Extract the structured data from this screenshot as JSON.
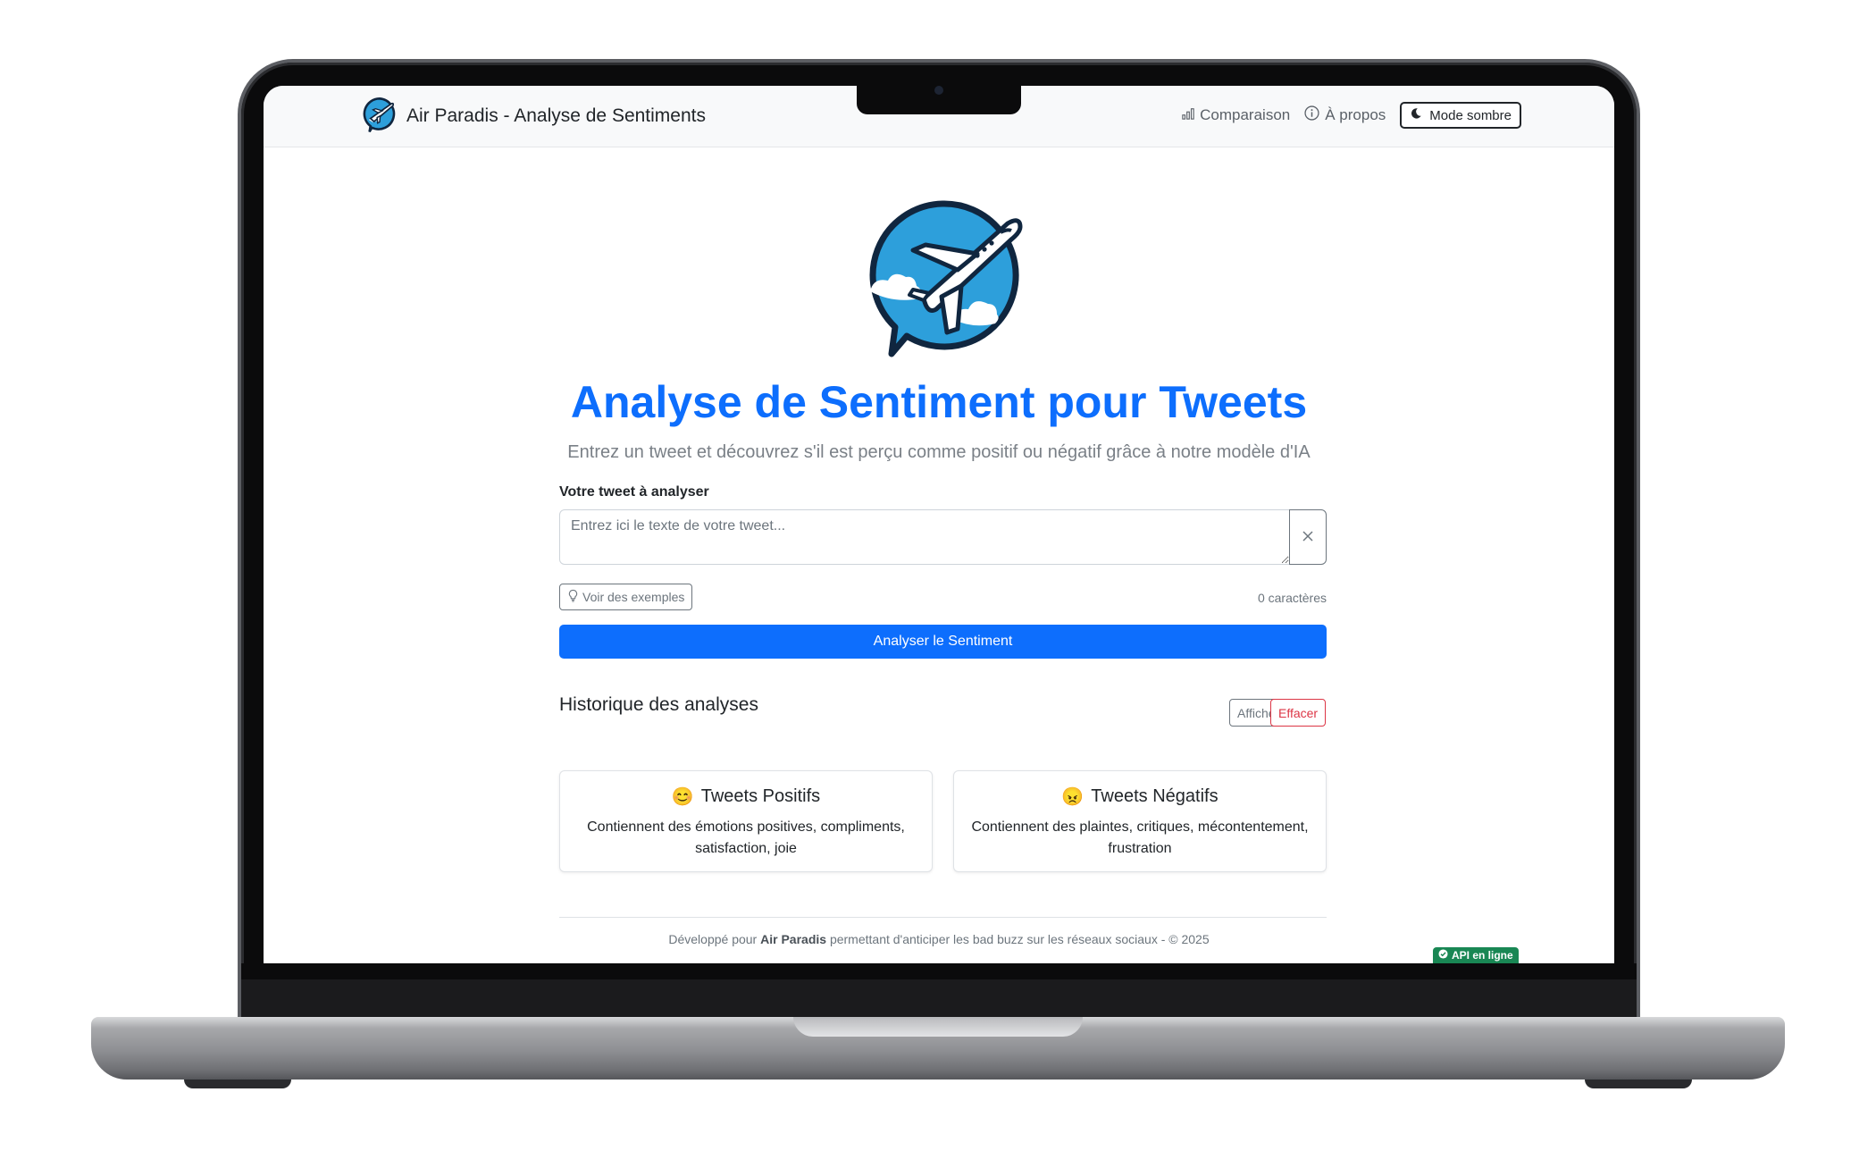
{
  "navbar": {
    "brand_title": "Air Paradis - Analyse de Sentiments",
    "links": [
      {
        "label": "Comparaison",
        "icon": "bar-chart-icon"
      },
      {
        "label": "À propos",
        "icon": "info-circle-icon"
      }
    ],
    "dark_mode_label": "Mode sombre"
  },
  "hero": {
    "title": "Analyse de Sentiment pour Tweets",
    "subtitle": "Entrez un tweet et découvrez s'il est perçu comme positif ou négatif grâce à notre modèle d'IA"
  },
  "form": {
    "label": "Votre tweet à analyser",
    "placeholder": "Entrez ici le texte de votre tweet...",
    "value": "",
    "examples_label": "Voir des exemples",
    "char_count": "0 caractères",
    "analyze_label": "Analyser le Sentiment"
  },
  "history": {
    "title": "Historique des analyses",
    "show_label": "Afficher",
    "clear_label": "Effacer"
  },
  "cards": {
    "positive": {
      "emoji": "😊",
      "title": "Tweets Positifs",
      "description": "Contiennent des émotions positives, compliments, satisfaction, joie"
    },
    "negative": {
      "emoji": "😠",
      "title": "Tweets Négatifs",
      "description": "Contiennent des plaintes, critiques, mécontentement, frustration"
    }
  },
  "footer": {
    "prefix": "Développé pour ",
    "brand": "Air Paradis",
    "suffix": " permettant d'anticiper les bad buzz sur les réseaux sociaux - © 2025"
  },
  "status": {
    "api_label": "API en ligne"
  },
  "colors": {
    "primary": "#0d6efd",
    "danger": "#dc3545",
    "success": "#198754",
    "logo_blue": "#2d9fdb",
    "logo_outline": "#10263f"
  }
}
